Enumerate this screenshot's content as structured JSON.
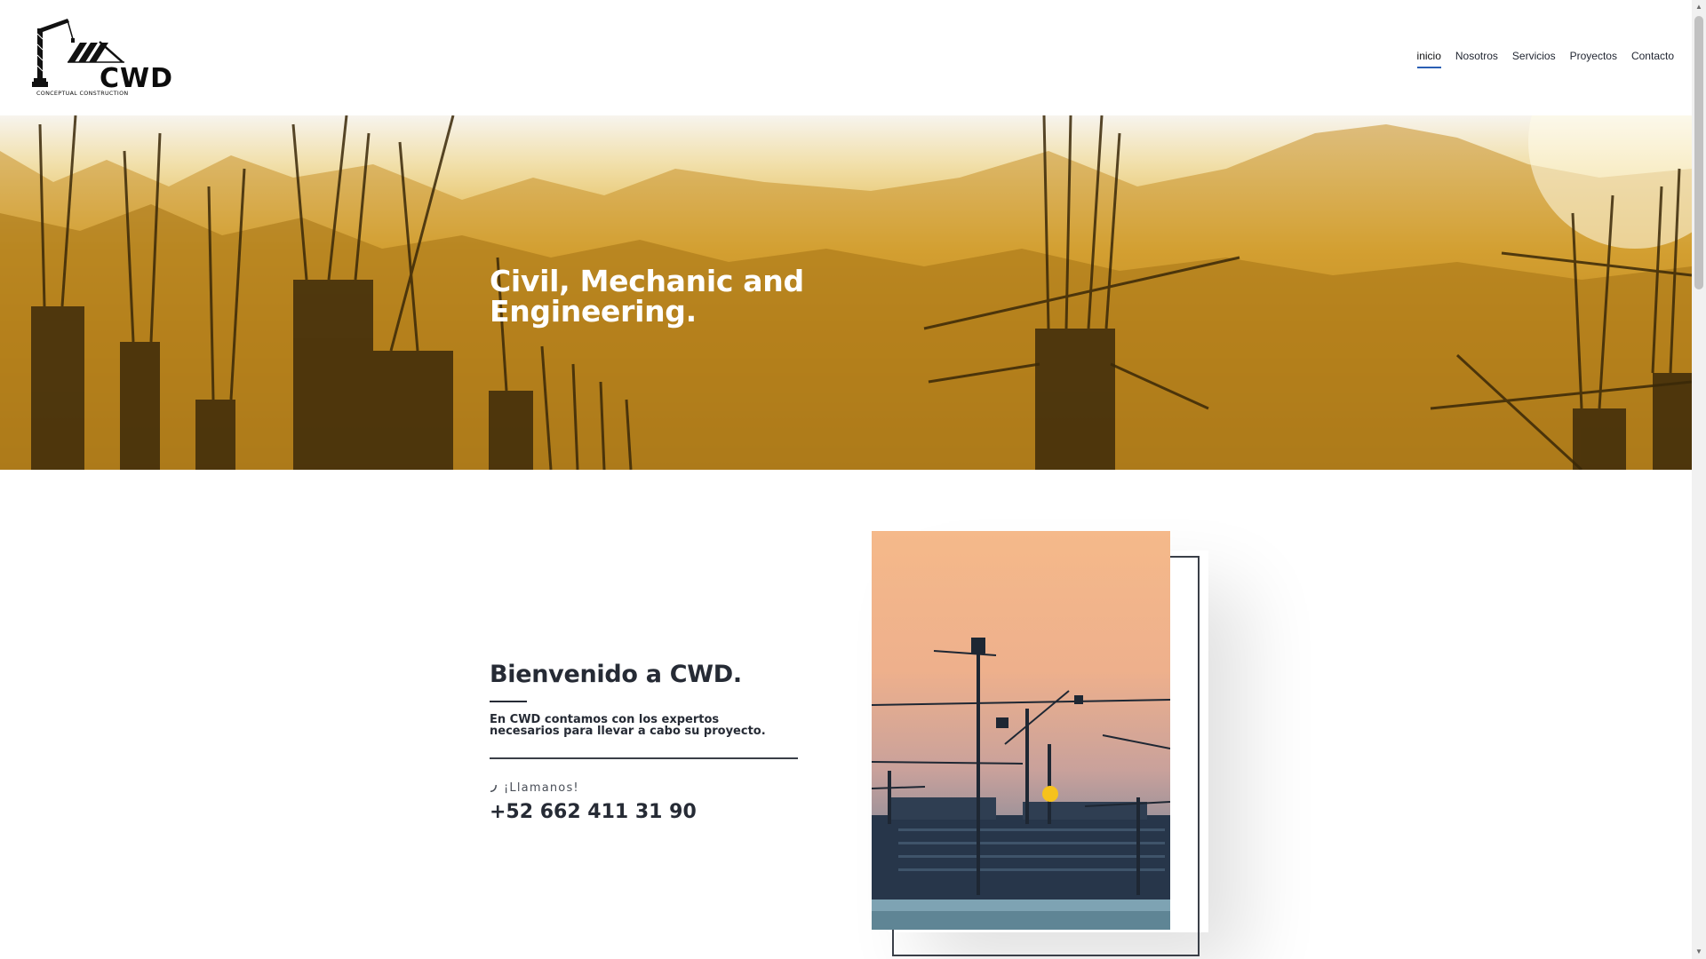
{
  "brand": {
    "logo_text": "CWD",
    "logo_subtitle": "CONCEPTUAL CONSTRUCTION"
  },
  "nav": {
    "items": [
      {
        "label": "inicio",
        "active": true
      },
      {
        "label": "Nosotros",
        "active": false
      },
      {
        "label": "Servicios",
        "active": false
      },
      {
        "label": "Proyectos",
        "active": false
      },
      {
        "label": "Contacto",
        "active": false
      }
    ]
  },
  "hero": {
    "title": "Civil, Mechanic and Engineering."
  },
  "welcome": {
    "title": "Bienvenido a CWD.",
    "text": "En CWD contamos con los expertos necesarios para llevar a cabo su proyecto.",
    "call_label": "¡Llamanos!",
    "phone": "+52 662 411 31 90"
  },
  "colors": {
    "accent": "#2b5fb4",
    "text": "#262b35",
    "hero_gold": "#d9a52f",
    "photo_sky": "#f5b98a"
  },
  "icons": {
    "phone": "phone-icon",
    "logo": "crane-logo-icon"
  }
}
